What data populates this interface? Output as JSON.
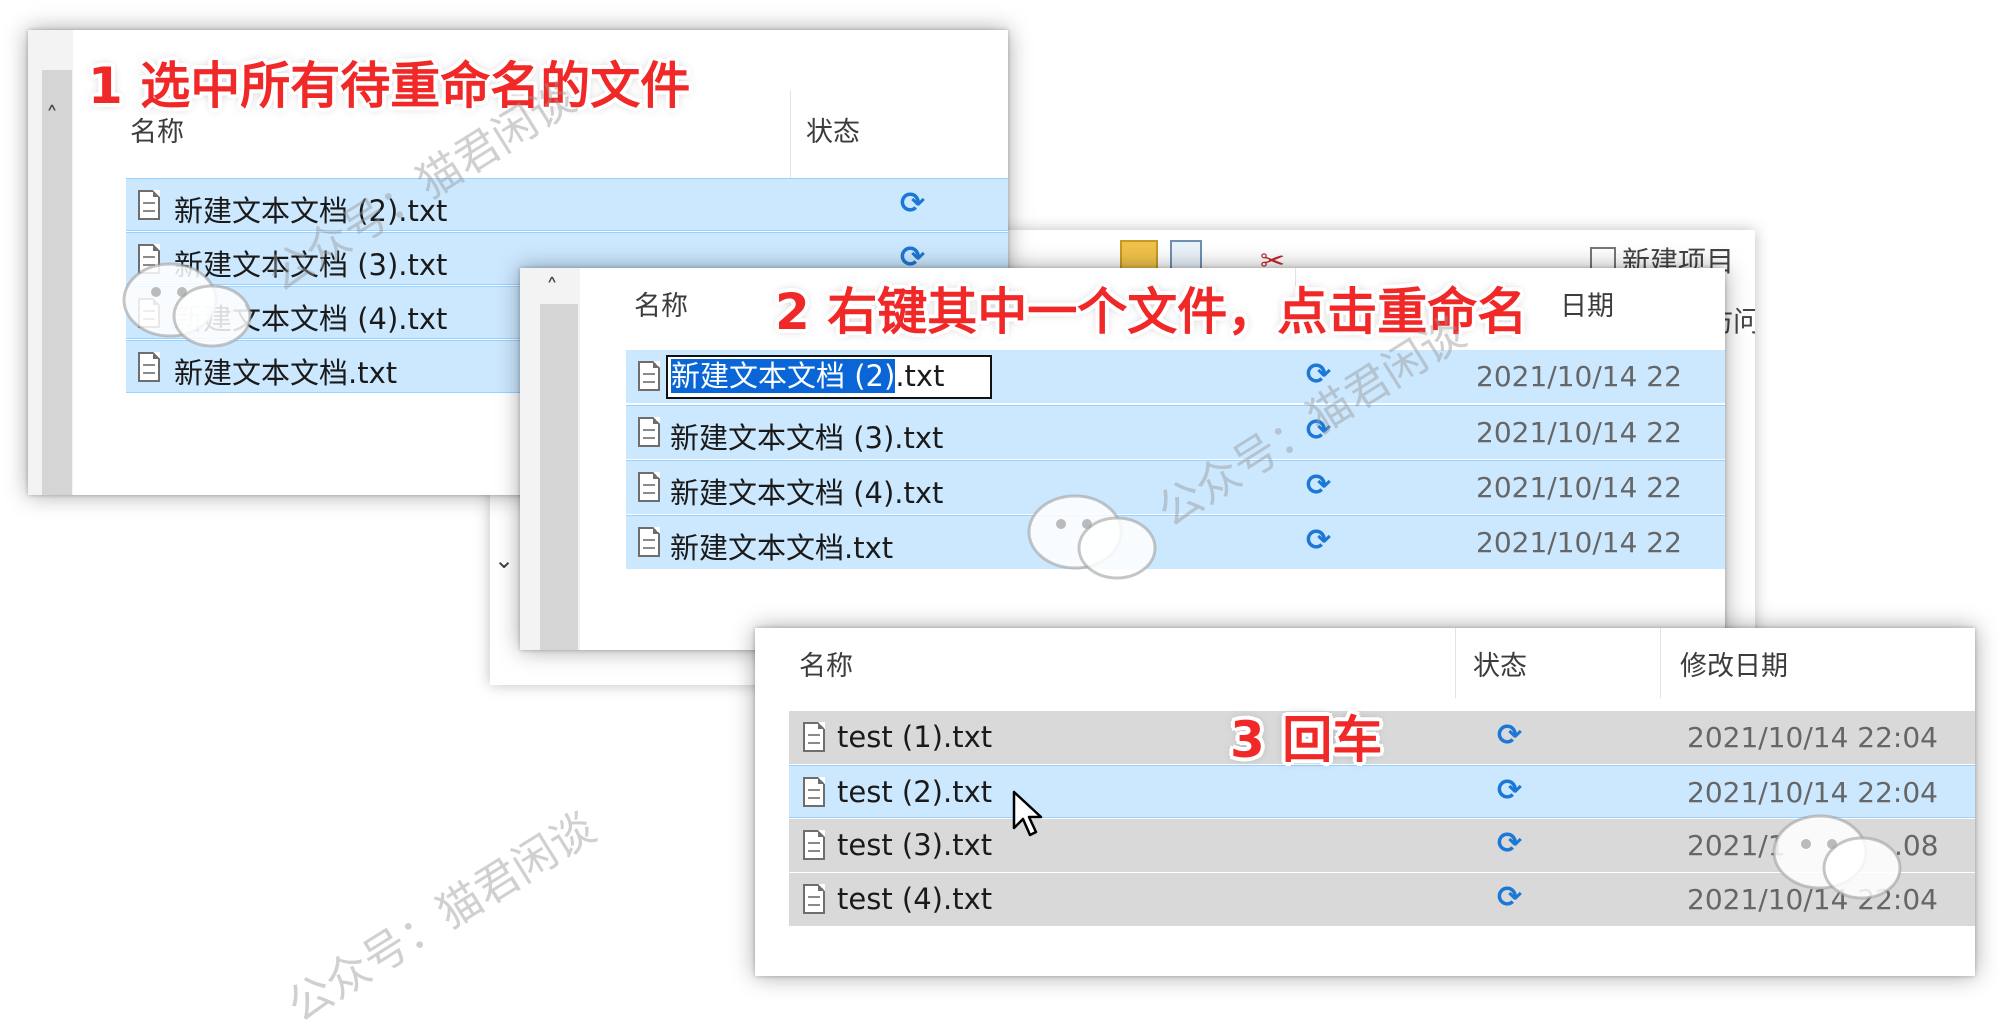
{
  "annotations": {
    "step1": "1 选中所有待重命名的文件",
    "step2": "2 右键其中一个文件，点击重命名",
    "step3": "3 回车"
  },
  "columns": {
    "name": "名称",
    "status": "状态",
    "modified": "修改日期",
    "modified_partial": "日期"
  },
  "panel1": {
    "files": [
      "新建文本文档 (2).txt",
      "新建文本文档 (3).txt",
      "新建文本文档 (4).txt",
      "新建文本文档.txt"
    ]
  },
  "panel2": {
    "rename_selected": "新建文本文档 (2)",
    "rename_ext": ".txt",
    "files": [
      "新建文本文档 (3).txt",
      "新建文本文档 (4).txt",
      "新建文本文档.txt"
    ],
    "date": "2021/10/14 22",
    "toolbar_new_item": "新建项目",
    "toolbar_fragment": "访问"
  },
  "panel3": {
    "files": [
      {
        "name": "test (1).txt",
        "date": "2021/10/14 22:04"
      },
      {
        "name": "test (2).txt",
        "date": "2021/10/14 22:04"
      },
      {
        "name": "test (3).txt",
        "date": "2021/1",
        "date_tail": ".08"
      },
      {
        "name": "test (4).txt",
        "date": "2021/10/14 22:04"
      }
    ]
  },
  "watermark": {
    "text": "公众号：猫君闲谈"
  },
  "colors": {
    "selection": "#cce8ff",
    "selection_border": "#99d1ff",
    "annotation": "#f02828",
    "sync_icon": "#1c78d6"
  }
}
